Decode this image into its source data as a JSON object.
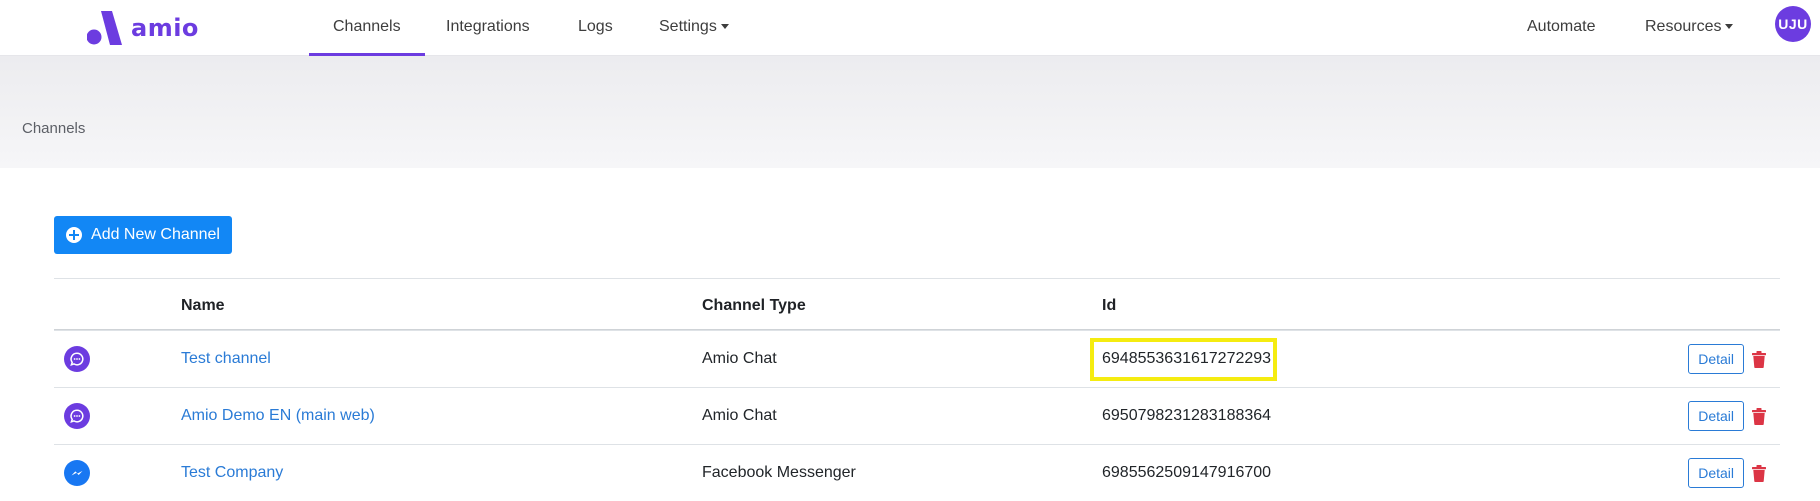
{
  "brand": {
    "name": "amio",
    "color": "#6c3ce0"
  },
  "nav": {
    "items": [
      {
        "label": "Channels",
        "active": true
      },
      {
        "label": "Integrations",
        "active": false
      },
      {
        "label": "Logs",
        "active": false
      },
      {
        "label": "Settings",
        "active": false,
        "dropdown": true
      }
    ],
    "right": [
      {
        "label": "Automate",
        "dropdown": false
      },
      {
        "label": "Resources",
        "dropdown": true
      }
    ],
    "avatar_initials": "UJU"
  },
  "breadcrumb": "Channels",
  "actions": {
    "add_channel_label": "Add New Channel"
  },
  "table": {
    "headers": [
      "Name",
      "Channel Type",
      "Id"
    ],
    "rows": [
      {
        "icon": "amio-chat-icon",
        "name": "Test channel",
        "type": "Amio Chat",
        "id": "6948553631617272293",
        "highlighted": true,
        "detail_label": "Detail"
      },
      {
        "icon": "amio-chat-icon",
        "name": "Amio Demo EN (main web)",
        "type": "Amio Chat",
        "id": "6950798231283188364",
        "highlighted": false,
        "detail_label": "Detail"
      },
      {
        "icon": "messenger-icon",
        "name": "Test Company",
        "type": "Facebook Messenger",
        "id": "6985562509147916700",
        "highlighted": false,
        "detail_label": "Detail"
      }
    ]
  },
  "colors": {
    "accent": "#6c3ce0",
    "primary_button": "#1287f5",
    "link": "#2a7bd6",
    "danger": "#dc3545",
    "highlight": "#f5ec10",
    "messenger": "#1877f2"
  }
}
